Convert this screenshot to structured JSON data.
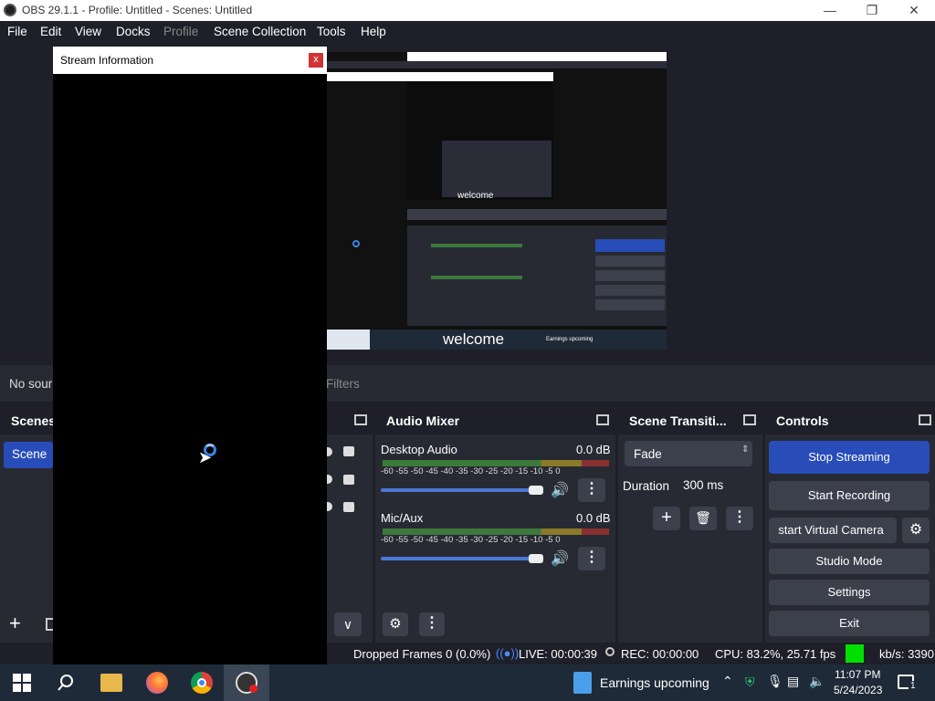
{
  "window": {
    "title": "OBS 29.1.1 - Profile: Untitled - Scenes: Untitled"
  },
  "menu": [
    "File",
    "Edit",
    "View",
    "Docks",
    "Profile",
    "Scene Collection",
    "Tools",
    "Help"
  ],
  "source_bar": {
    "no_source": "No sour",
    "filters": "Filters"
  },
  "scenes": {
    "title": "Scenes",
    "item": "Scene"
  },
  "audio_mixer": {
    "title": "Audio Mixer",
    "channels": [
      {
        "name": "Desktop Audio",
        "db": "0.0 dB",
        "level": 0.0
      },
      {
        "name": "Mic/Aux",
        "db": "0.0 dB",
        "level": 0.0
      }
    ],
    "ticks": [
      "-60",
      "-55",
      "-50",
      "-45",
      "-40",
      "-35",
      "-30",
      "-25",
      "-20",
      "-15",
      "-10",
      "-5",
      "0"
    ]
  },
  "transitions": {
    "title": "Scene Transiti...",
    "selected": "Fade",
    "duration_label": "Duration",
    "duration_value": "300 ms"
  },
  "controls": {
    "title": "Controls",
    "stop_streaming": "Stop Streaming",
    "start_recording": "Start Recording",
    "virtual_camera": "start Virtual Camera",
    "studio_mode": "Studio Mode",
    "settings": "Settings",
    "exit": "Exit"
  },
  "status": {
    "dropped": "Dropped Frames 0 (0.0%)",
    "live": "LIVE: 00:00:39",
    "rec": "REC: 00:00:00",
    "cpu": "CPU: 83.2%, 25.71 fps",
    "kbps": "kb/s: 3390"
  },
  "dialog": {
    "title": "Stream Information",
    "close": "x"
  },
  "nested_preview": {
    "welcome": "welcome",
    "welcome_small": "welcome",
    "earnings": "Earnings upcoming"
  },
  "taskbar": {
    "news": "Earnings upcoming",
    "time": "11:07 PM",
    "date": "5/24/2023",
    "notifications": "1"
  },
  "colors": {
    "accent": "#284cb8",
    "stream_indicator": "#00e000"
  }
}
